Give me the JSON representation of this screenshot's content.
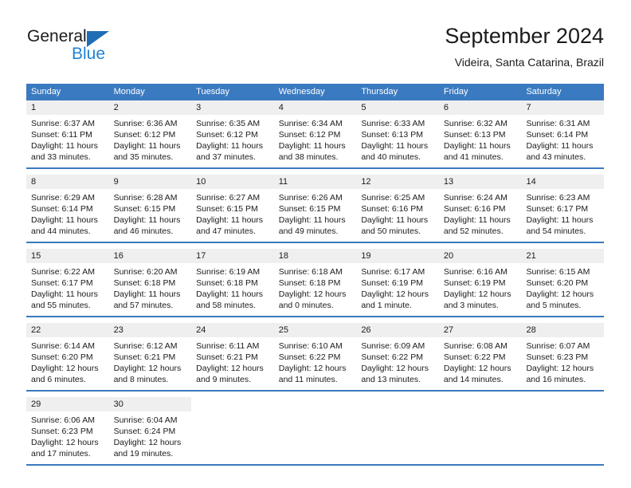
{
  "logo": {
    "word1": "General",
    "word2": "Blue",
    "triangle_color": "#1f6db4",
    "word2_color": "#1f82d4"
  },
  "header": {
    "title": "September 2024",
    "subtitle": "Videira, Santa Catarina, Brazil"
  },
  "calendar": {
    "header_bg": "#3a7ac0",
    "day_number_bg": "#efefef",
    "weekdays": [
      "Sunday",
      "Monday",
      "Tuesday",
      "Wednesday",
      "Thursday",
      "Friday",
      "Saturday"
    ],
    "weeks": [
      [
        {
          "day": "1",
          "sunrise": "Sunrise: 6:37 AM",
          "sunset": "Sunset: 6:11 PM",
          "daylight": "Daylight: 11 hours and 33 minutes."
        },
        {
          "day": "2",
          "sunrise": "Sunrise: 6:36 AM",
          "sunset": "Sunset: 6:12 PM",
          "daylight": "Daylight: 11 hours and 35 minutes."
        },
        {
          "day": "3",
          "sunrise": "Sunrise: 6:35 AM",
          "sunset": "Sunset: 6:12 PM",
          "daylight": "Daylight: 11 hours and 37 minutes."
        },
        {
          "day": "4",
          "sunrise": "Sunrise: 6:34 AM",
          "sunset": "Sunset: 6:12 PM",
          "daylight": "Daylight: 11 hours and 38 minutes."
        },
        {
          "day": "5",
          "sunrise": "Sunrise: 6:33 AM",
          "sunset": "Sunset: 6:13 PM",
          "daylight": "Daylight: 11 hours and 40 minutes."
        },
        {
          "day": "6",
          "sunrise": "Sunrise: 6:32 AM",
          "sunset": "Sunset: 6:13 PM",
          "daylight": "Daylight: 11 hours and 41 minutes."
        },
        {
          "day": "7",
          "sunrise": "Sunrise: 6:31 AM",
          "sunset": "Sunset: 6:14 PM",
          "daylight": "Daylight: 11 hours and 43 minutes."
        }
      ],
      [
        {
          "day": "8",
          "sunrise": "Sunrise: 6:29 AM",
          "sunset": "Sunset: 6:14 PM",
          "daylight": "Daylight: 11 hours and 44 minutes."
        },
        {
          "day": "9",
          "sunrise": "Sunrise: 6:28 AM",
          "sunset": "Sunset: 6:15 PM",
          "daylight": "Daylight: 11 hours and 46 minutes."
        },
        {
          "day": "10",
          "sunrise": "Sunrise: 6:27 AM",
          "sunset": "Sunset: 6:15 PM",
          "daylight": "Daylight: 11 hours and 47 minutes."
        },
        {
          "day": "11",
          "sunrise": "Sunrise: 6:26 AM",
          "sunset": "Sunset: 6:15 PM",
          "daylight": "Daylight: 11 hours and 49 minutes."
        },
        {
          "day": "12",
          "sunrise": "Sunrise: 6:25 AM",
          "sunset": "Sunset: 6:16 PM",
          "daylight": "Daylight: 11 hours and 50 minutes."
        },
        {
          "day": "13",
          "sunrise": "Sunrise: 6:24 AM",
          "sunset": "Sunset: 6:16 PM",
          "daylight": "Daylight: 11 hours and 52 minutes."
        },
        {
          "day": "14",
          "sunrise": "Sunrise: 6:23 AM",
          "sunset": "Sunset: 6:17 PM",
          "daylight": "Daylight: 11 hours and 54 minutes."
        }
      ],
      [
        {
          "day": "15",
          "sunrise": "Sunrise: 6:22 AM",
          "sunset": "Sunset: 6:17 PM",
          "daylight": "Daylight: 11 hours and 55 minutes."
        },
        {
          "day": "16",
          "sunrise": "Sunrise: 6:20 AM",
          "sunset": "Sunset: 6:18 PM",
          "daylight": "Daylight: 11 hours and 57 minutes."
        },
        {
          "day": "17",
          "sunrise": "Sunrise: 6:19 AM",
          "sunset": "Sunset: 6:18 PM",
          "daylight": "Daylight: 11 hours and 58 minutes."
        },
        {
          "day": "18",
          "sunrise": "Sunrise: 6:18 AM",
          "sunset": "Sunset: 6:18 PM",
          "daylight": "Daylight: 12 hours and 0 minutes."
        },
        {
          "day": "19",
          "sunrise": "Sunrise: 6:17 AM",
          "sunset": "Sunset: 6:19 PM",
          "daylight": "Daylight: 12 hours and 1 minute."
        },
        {
          "day": "20",
          "sunrise": "Sunrise: 6:16 AM",
          "sunset": "Sunset: 6:19 PM",
          "daylight": "Daylight: 12 hours and 3 minutes."
        },
        {
          "day": "21",
          "sunrise": "Sunrise: 6:15 AM",
          "sunset": "Sunset: 6:20 PM",
          "daylight": "Daylight: 12 hours and 5 minutes."
        }
      ],
      [
        {
          "day": "22",
          "sunrise": "Sunrise: 6:14 AM",
          "sunset": "Sunset: 6:20 PM",
          "daylight": "Daylight: 12 hours and 6 minutes."
        },
        {
          "day": "23",
          "sunrise": "Sunrise: 6:12 AM",
          "sunset": "Sunset: 6:21 PM",
          "daylight": "Daylight: 12 hours and 8 minutes."
        },
        {
          "day": "24",
          "sunrise": "Sunrise: 6:11 AM",
          "sunset": "Sunset: 6:21 PM",
          "daylight": "Daylight: 12 hours and 9 minutes."
        },
        {
          "day": "25",
          "sunrise": "Sunrise: 6:10 AM",
          "sunset": "Sunset: 6:22 PM",
          "daylight": "Daylight: 12 hours and 11 minutes."
        },
        {
          "day": "26",
          "sunrise": "Sunrise: 6:09 AM",
          "sunset": "Sunset: 6:22 PM",
          "daylight": "Daylight: 12 hours and 13 minutes."
        },
        {
          "day": "27",
          "sunrise": "Sunrise: 6:08 AM",
          "sunset": "Sunset: 6:22 PM",
          "daylight": "Daylight: 12 hours and 14 minutes."
        },
        {
          "day": "28",
          "sunrise": "Sunrise: 6:07 AM",
          "sunset": "Sunset: 6:23 PM",
          "daylight": "Daylight: 12 hours and 16 minutes."
        }
      ],
      [
        {
          "day": "29",
          "sunrise": "Sunrise: 6:06 AM",
          "sunset": "Sunset: 6:23 PM",
          "daylight": "Daylight: 12 hours and 17 minutes."
        },
        {
          "day": "30",
          "sunrise": "Sunrise: 6:04 AM",
          "sunset": "Sunset: 6:24 PM",
          "daylight": "Daylight: 12 hours and 19 minutes."
        },
        {
          "day": "",
          "sunrise": "",
          "sunset": "",
          "daylight": ""
        },
        {
          "day": "",
          "sunrise": "",
          "sunset": "",
          "daylight": ""
        },
        {
          "day": "",
          "sunrise": "",
          "sunset": "",
          "daylight": ""
        },
        {
          "day": "",
          "sunrise": "",
          "sunset": "",
          "daylight": ""
        },
        {
          "day": "",
          "sunrise": "",
          "sunset": "",
          "daylight": ""
        }
      ]
    ]
  }
}
